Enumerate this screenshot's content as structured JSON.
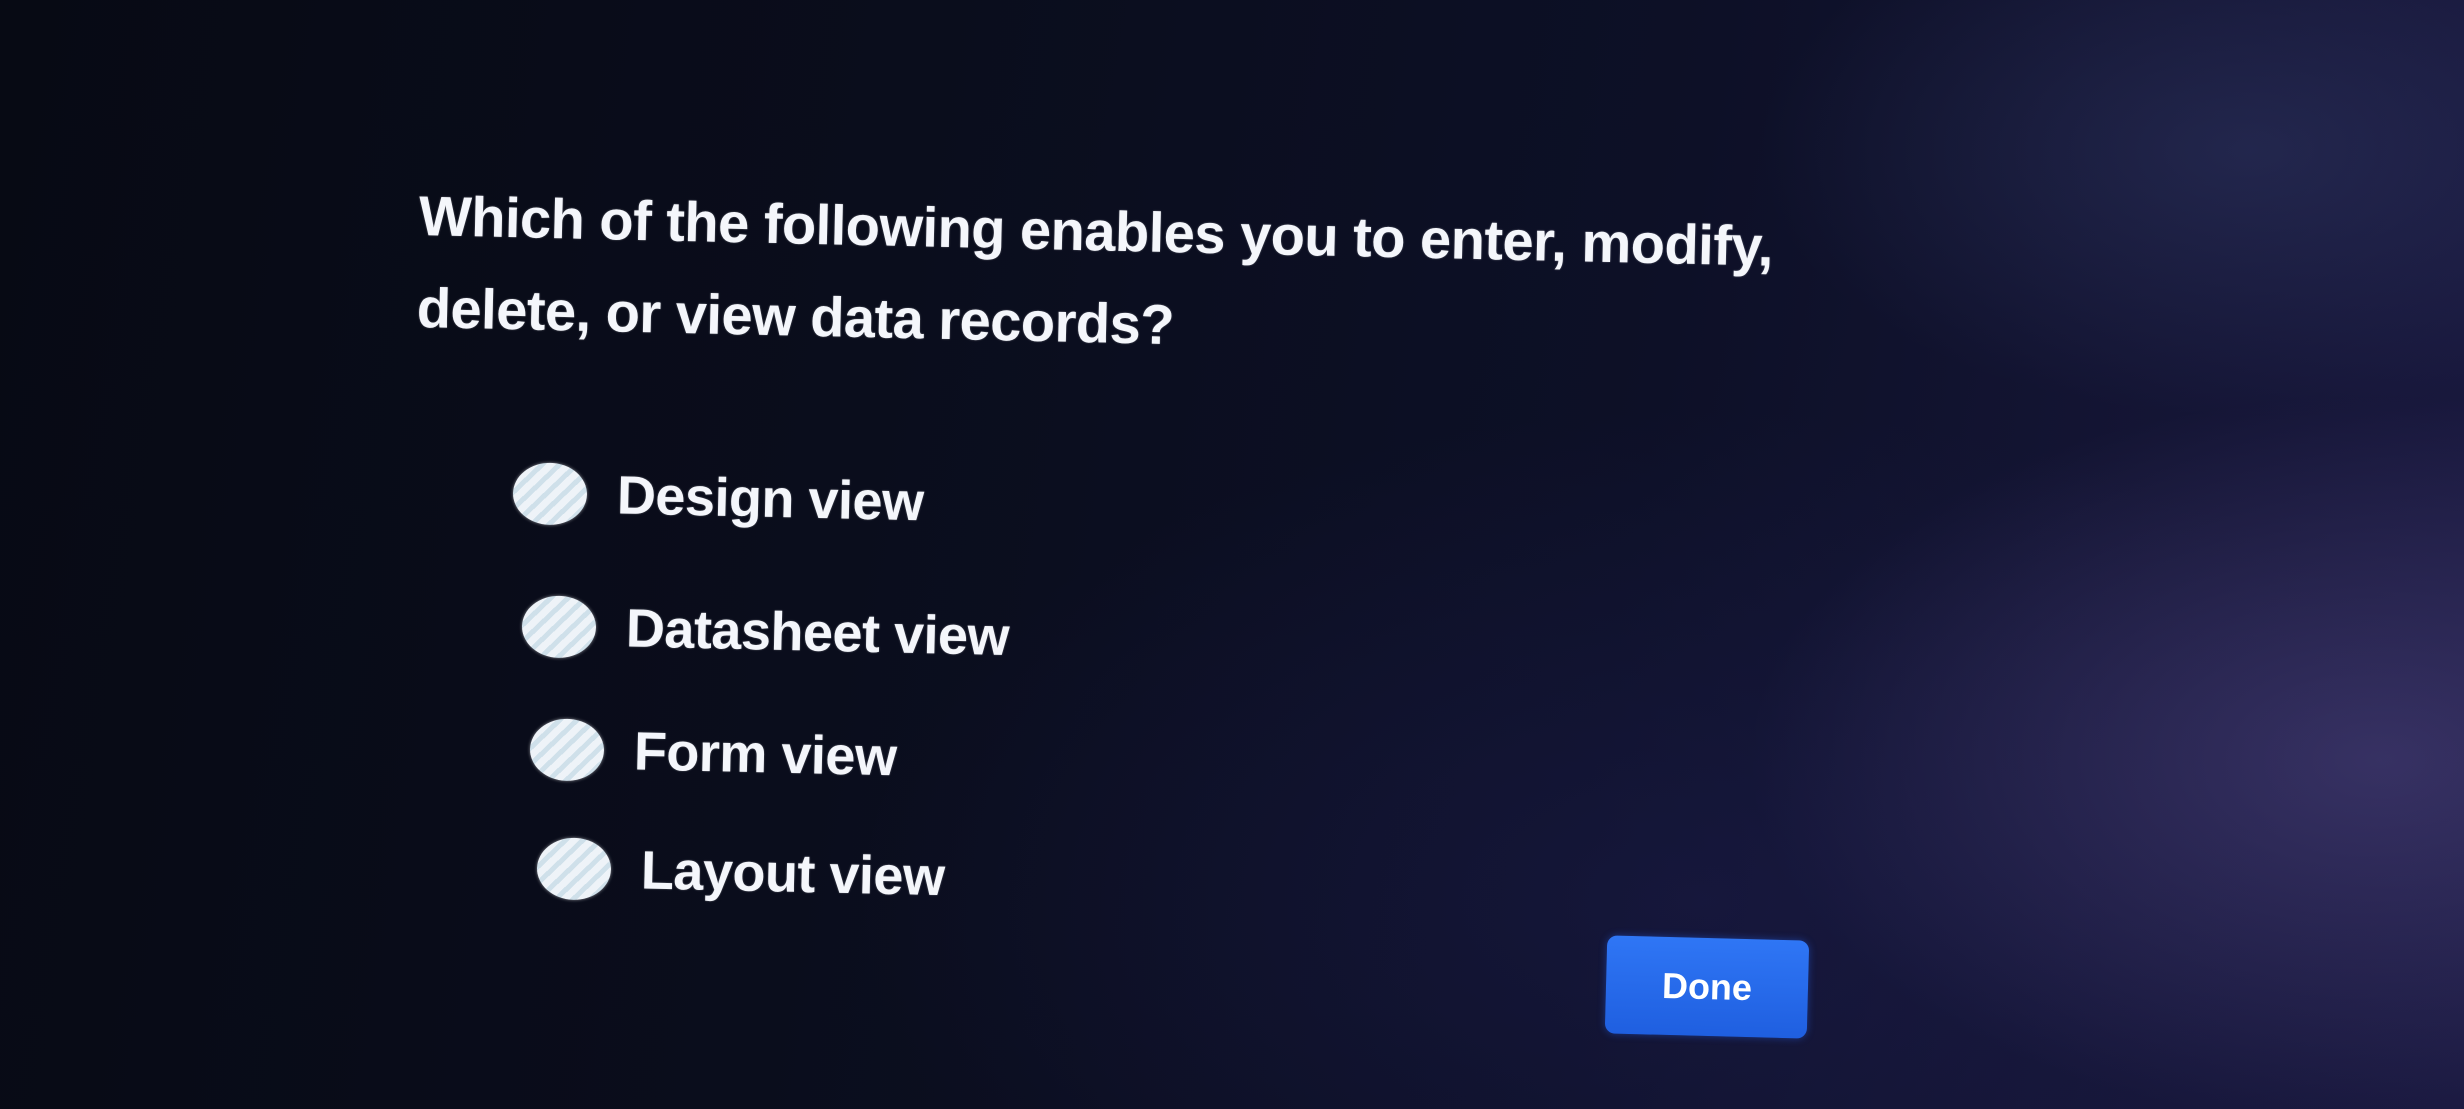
{
  "question": {
    "text": "Which of the following enables you to enter, modify, delete, or view data records?"
  },
  "options": [
    {
      "label": "Design view",
      "selected": false
    },
    {
      "label": "Datasheet view",
      "selected": false
    },
    {
      "label": "Form view",
      "selected": false
    },
    {
      "label": "Layout view",
      "selected": false
    }
  ],
  "actions": {
    "done_label": "Done"
  },
  "colors": {
    "background": "#0a0d1c",
    "text": "#f4f6fb",
    "accent": "#2a6ef0"
  }
}
